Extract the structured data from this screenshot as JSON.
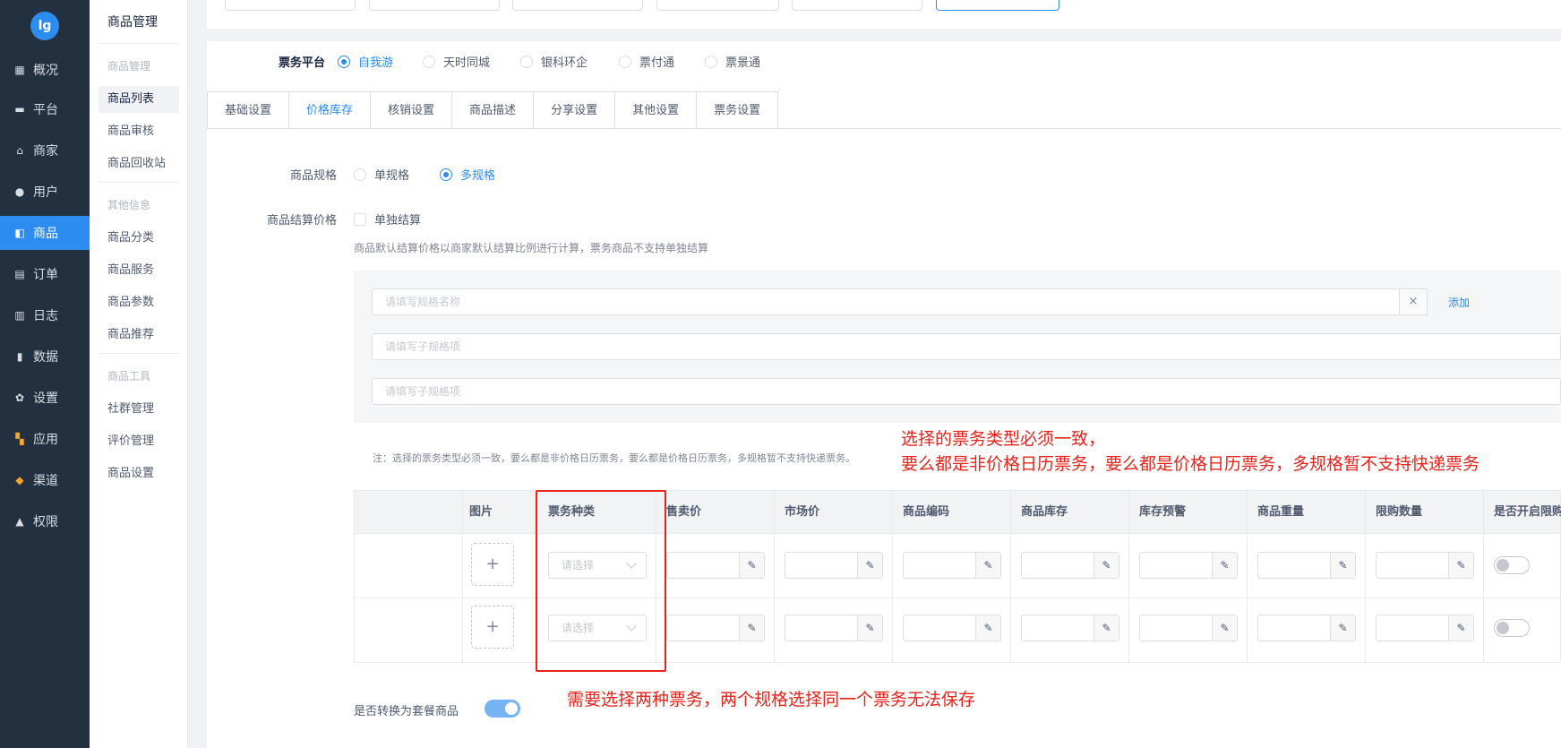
{
  "logo": {
    "text": "lg"
  },
  "nav": [
    {
      "label": "概况",
      "icon": "chart-icon"
    },
    {
      "label": "平台",
      "icon": "monitor-icon"
    },
    {
      "label": "商家",
      "icon": "store-icon"
    },
    {
      "label": "用户",
      "icon": "user-icon"
    },
    {
      "label": "商品",
      "icon": "bag-icon",
      "active": true
    },
    {
      "label": "订单",
      "icon": "order-icon"
    },
    {
      "label": "日志",
      "icon": "log-icon"
    },
    {
      "label": "数据",
      "icon": "bar-chart-icon"
    },
    {
      "label": "设置",
      "icon": "gear-icon"
    },
    {
      "label": "应用",
      "icon": "apps-icon"
    },
    {
      "label": "渠道",
      "icon": "cube-icon"
    },
    {
      "label": "权限",
      "icon": "lock-icon"
    }
  ],
  "submenu": {
    "title": "商品管理",
    "group1": "商品管理",
    "items1": [
      "商品列表",
      "商品审核",
      "商品回收站"
    ],
    "group2": "其他信息",
    "items2": [
      "商品分类",
      "商品服务",
      "商品参数",
      "商品推荐"
    ],
    "group3": "商品工具",
    "items3": [
      "社群管理",
      "评价管理",
      "商品设置"
    ]
  },
  "ticket_platform": {
    "label": "票务平台",
    "options": [
      "自我游",
      "天时同城",
      "银科环企",
      "票付通",
      "票景通"
    ],
    "selected": "自我游"
  },
  "tabs": [
    "基础设置",
    "价格库存",
    "核销设置",
    "商品描述",
    "分享设置",
    "其他设置",
    "票务设置"
  ],
  "active_tab": "价格库存",
  "spec": {
    "label": "商品规格",
    "options": [
      "单规格",
      "多规格"
    ],
    "selected": "多规格"
  },
  "settlement": {
    "label": "商品结算价格",
    "checkbox_label": "单独结算",
    "checked": false,
    "hint": "商品默认结算价格以商家默认结算比例进行计算，票务商品不支持单独结算"
  },
  "spec_panel": {
    "name_placeholder": "请填写规格名称",
    "clear": "×",
    "add": "添加",
    "item_placeholder": "请填写子规格项"
  },
  "note": "注：选择的票务类型必须一致，要么都是非价格日历票务，要么都是价格日历票务，多规格暂不支持快递票务。",
  "red_note_1": "选择的票务类型必须一致，",
  "red_note_2": "要么都是非价格日历票务，要么都是价格日历票务，多规格暂不支持快递票务",
  "table": {
    "headers": [
      "图片",
      "票务种类",
      "售卖价",
      "市场价",
      "商品编码",
      "商品库存",
      "库存预警",
      "商品重量",
      "限购数量",
      "是否开启限购"
    ],
    "select_placeholder": "请选择",
    "upload": "+",
    "edit": "✎",
    "rows": 2
  },
  "combo": {
    "label": "是否转换为套餐商品",
    "on": true
  },
  "red_note_3": "需要选择两种票务，两个规格选择同一个票务无法保存"
}
